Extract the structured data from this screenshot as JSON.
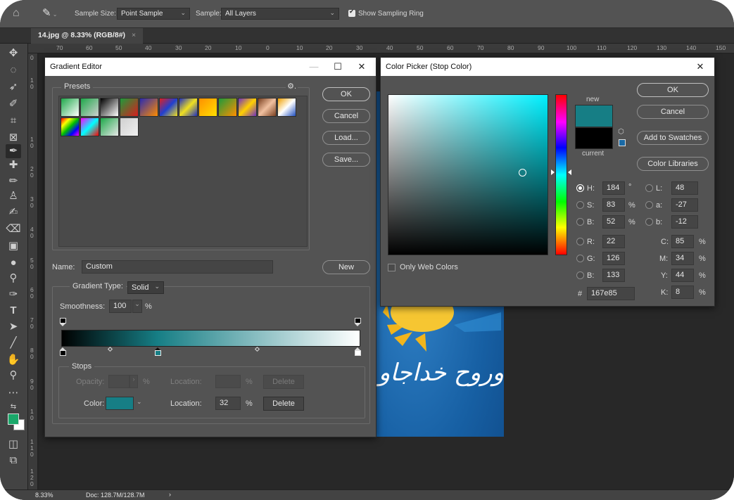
{
  "options_bar": {
    "sample_size_label": "Sample Size:",
    "sample_size_value": "Point Sample",
    "sample_label": "Sample:",
    "sample_value": "All Layers",
    "show_ring_label": "Show Sampling Ring"
  },
  "document_tab": {
    "title": "14.jpg @ 8.33% (RGB/8#)",
    "close": "×"
  },
  "rulers": {
    "h_ticks": [
      "70",
      "60",
      "50",
      "40",
      "30",
      "20",
      "10",
      "0",
      "10",
      "20",
      "30",
      "40",
      "50",
      "60",
      "70",
      "80",
      "90",
      "100",
      "110",
      "120",
      "130",
      "140",
      "150"
    ],
    "v_ticks": [
      "0",
      "1 0",
      "1 0",
      "2 0",
      "3 0",
      "4 0",
      "5 0",
      "6 0",
      "7 0",
      "8 0",
      "9 0",
      "1 0",
      "1 1 0",
      "1 2 0"
    ]
  },
  "image": {
    "arabic_text": "وروح خداجاو"
  },
  "status": {
    "zoom": "8.33%",
    "doc": "Doc: 128.7M/128.7M",
    "arrow": "›"
  },
  "gradient_editor": {
    "title": "Gradient Editor",
    "presets_label": "Presets",
    "buttons": {
      "ok": "OK",
      "cancel": "Cancel",
      "load": "Load...",
      "save": "Save...",
      "new": "New"
    },
    "name_label": "Name:",
    "name_value": "Custom",
    "gradient_type_label": "Gradient Type:",
    "gradient_type_value": "Solid",
    "smoothness_label": "Smoothness:",
    "smoothness_value": "100",
    "smoothness_unit": "%",
    "stops_label": "Stops",
    "opacity_label": "Opacity:",
    "opacity_value": "",
    "opacity_unit": "%",
    "location_label": "Location:",
    "location_unit": "%",
    "delete_label": "Delete",
    "color_label": "Color:",
    "color_location_value": "32",
    "stop_color": "#167e85",
    "gradient_stops": [
      {
        "color": "#000000",
        "location": 0
      },
      {
        "color": "#167e85",
        "location": 32
      },
      {
        "color": "#ffffff",
        "location": 100
      }
    ],
    "presets": [
      {
        "colors": [
          "#1ea84a",
          "#ffffff"
        ]
      },
      {
        "colors": [
          "#1ea84a",
          "#d0d0d0"
        ]
      },
      {
        "colors": [
          "#000000",
          "#ffffff"
        ]
      },
      {
        "colors": [
          "#1e9a3a",
          "#d81e1e"
        ]
      },
      {
        "colors": [
          "#2a2ab0",
          "#ff8c00"
        ]
      },
      {
        "colors": [
          "#e02020",
          "#2040d0",
          "#f0e020"
        ]
      },
      {
        "colors": [
          "#2030c0",
          "#f0e020",
          "#2030c0"
        ]
      },
      {
        "colors": [
          "#ff9000",
          "#ffe000"
        ]
      },
      {
        "colors": [
          "#1e9a3a",
          "#ff9000"
        ]
      },
      {
        "colors": [
          "#7030c0",
          "#ffd000",
          "#7030c0"
        ]
      },
      {
        "colors": [
          "#7a4020",
          "#f0c0a0",
          "#7a4020"
        ]
      },
      {
        "colors": [
          "#f0a000",
          "#ffffff",
          "#2050c0"
        ]
      },
      {
        "colors": [
          "#ff0000",
          "#ffff00",
          "#00c000",
          "#0000ff",
          "#ff00ff"
        ]
      },
      {
        "colors": [
          "#ff00ff",
          "#00ffff",
          "#ff0000"
        ]
      },
      {
        "colors": [
          "#1ea84a",
          "#e8e8e8"
        ]
      },
      {
        "colors": [
          "#d0d0d0",
          "#f0f0f0"
        ]
      }
    ]
  },
  "color_picker": {
    "title": "Color Picker (Stop Color)",
    "buttons": {
      "ok": "OK",
      "cancel": "Cancel",
      "add_swatches": "Add to Swatches",
      "libraries": "Color Libraries"
    },
    "new_label": "new",
    "current_label": "current",
    "new_color": "#167e85",
    "current_color": "#000000",
    "only_web_colors": "Only Web Colors",
    "fields": {
      "H": {
        "label": "H:",
        "value": "184",
        "unit": "°"
      },
      "S": {
        "label": "S:",
        "value": "83",
        "unit": "%"
      },
      "Bv": {
        "label": "B:",
        "value": "52",
        "unit": "%"
      },
      "R": {
        "label": "R:",
        "value": "22"
      },
      "G": {
        "label": "G:",
        "value": "126"
      },
      "Bc": {
        "label": "B:",
        "value": "133"
      },
      "L": {
        "label": "L:",
        "value": "48"
      },
      "a": {
        "label": "a:",
        "value": "-27"
      },
      "b": {
        "label": "b:",
        "value": "-12"
      },
      "C": {
        "label": "C:",
        "value": "85",
        "unit": "%"
      },
      "M": {
        "label": "M:",
        "value": "34",
        "unit": "%"
      },
      "Y": {
        "label": "Y:",
        "value": "44",
        "unit": "%"
      },
      "K": {
        "label": "K:",
        "value": "8",
        "unit": "%"
      }
    },
    "hex_label": "#",
    "hex_value": "167e85",
    "hue_color": "#00f0ff"
  }
}
